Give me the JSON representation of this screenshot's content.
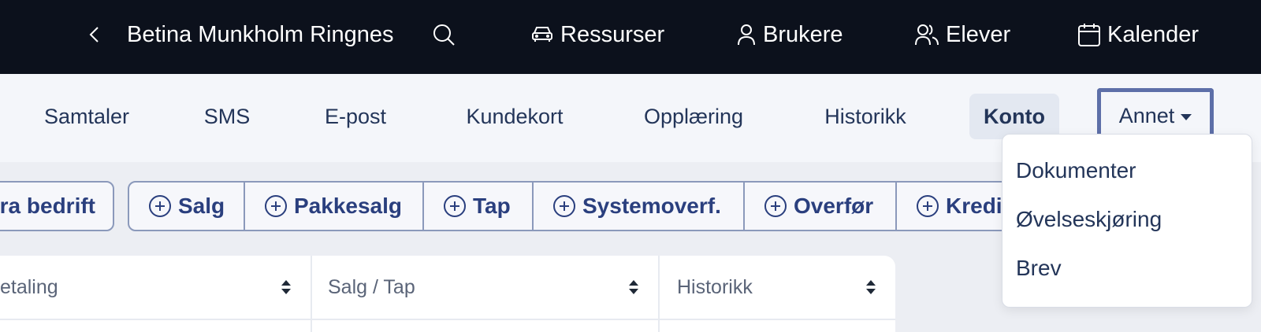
{
  "topbar": {
    "title": "Betina Munkholm Ringnes",
    "nav": [
      {
        "label": "Ressurser",
        "icon": "car-icon"
      },
      {
        "label": "Brukere",
        "icon": "user-icon"
      },
      {
        "label": "Elever",
        "icon": "users-icon"
      },
      {
        "label": "Kalender",
        "icon": "calendar-icon"
      }
    ]
  },
  "tabs": [
    {
      "label": "Samtaler"
    },
    {
      "label": "SMS"
    },
    {
      "label": "E-post"
    },
    {
      "label": "Kundekort"
    },
    {
      "label": "Opplæring"
    },
    {
      "label": "Historikk"
    },
    {
      "label": "Konto",
      "active": true
    },
    {
      "label": "Annet",
      "dropdown_open": true
    }
  ],
  "actions": {
    "first_label": "ra bedrift",
    "buttons": [
      {
        "label": "Salg"
      },
      {
        "label": "Pakkesalg"
      },
      {
        "label": "Tap"
      },
      {
        "label": "Systemoverf."
      },
      {
        "label": "Overfør"
      },
      {
        "label": "Kredi"
      }
    ]
  },
  "table": {
    "headers": [
      "etaling",
      "Salg / Tap",
      "Historikk"
    ]
  },
  "dropdown": {
    "items": [
      "Dokumenter",
      "Øvelseskjøring",
      "Brev"
    ]
  },
  "colors": {
    "topbar_bg": "#0c111c",
    "accent": "#2a3f7e",
    "annet_border": "#5d6fa8"
  }
}
